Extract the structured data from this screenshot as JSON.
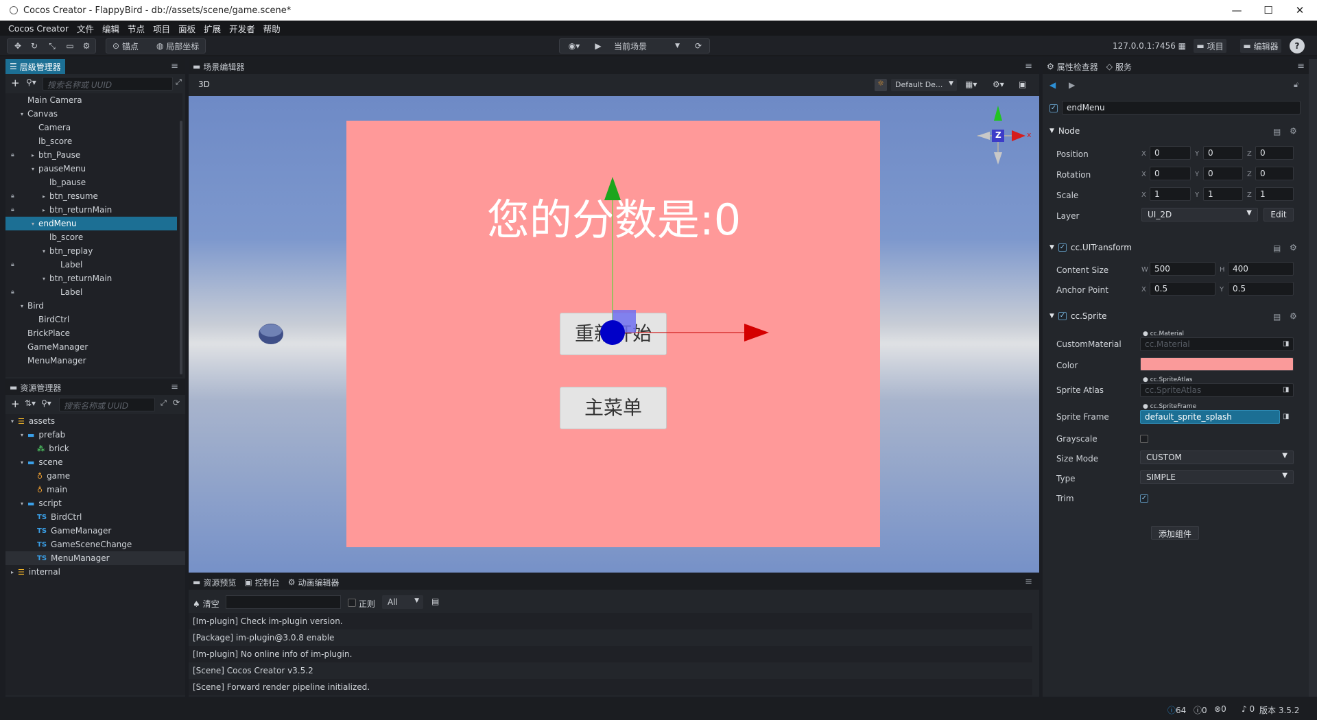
{
  "window": {
    "title": "Cocos Creator - FlappyBird - db://assets/scene/game.scene*",
    "controls": [
      "—",
      "☐",
      "✕"
    ]
  },
  "menubar": [
    "Cocos Creator",
    "文件",
    "编辑",
    "节点",
    "项目",
    "面板",
    "扩展",
    "开发者",
    "帮助"
  ],
  "toolbar": {
    "pivot": "锚点",
    "local": "局部坐标",
    "scene_select": "当前场景",
    "ip": "127.0.0.1:7456",
    "project_btn": "项目",
    "editor_btn": "编辑器"
  },
  "hierarchy": {
    "tab": "层级管理器",
    "search_placeholder": "搜索名称或 UUID",
    "items": [
      {
        "label": "Main Camera",
        "depth": 1,
        "arrow": "",
        "lock": false
      },
      {
        "label": "Canvas",
        "depth": 1,
        "arrow": "▾",
        "lock": false
      },
      {
        "label": "Camera",
        "depth": 2,
        "arrow": "",
        "lock": false
      },
      {
        "label": "lb_score",
        "depth": 2,
        "arrow": "",
        "lock": false
      },
      {
        "label": "btn_Pause",
        "depth": 2,
        "arrow": "▸",
        "lock": true
      },
      {
        "label": "pauseMenu",
        "depth": 2,
        "arrow": "▾",
        "lock": false
      },
      {
        "label": "lb_pause",
        "depth": 3,
        "arrow": "",
        "lock": false
      },
      {
        "label": "btn_resume",
        "depth": 3,
        "arrow": "▸",
        "lock": true
      },
      {
        "label": "btn_returnMain",
        "depth": 3,
        "arrow": "▸",
        "lock": true
      },
      {
        "label": "endMenu",
        "depth": 2,
        "arrow": "▾",
        "lock": false,
        "selected": true
      },
      {
        "label": "lb_score",
        "depth": 3,
        "arrow": "",
        "lock": false
      },
      {
        "label": "btn_replay",
        "depth": 3,
        "arrow": "▾",
        "lock": false
      },
      {
        "label": "Label",
        "depth": 4,
        "arrow": "",
        "lock": true
      },
      {
        "label": "btn_returnMain",
        "depth": 3,
        "arrow": "▾",
        "lock": false
      },
      {
        "label": "Label",
        "depth": 4,
        "arrow": "",
        "lock": true
      },
      {
        "label": "Bird",
        "depth": 1,
        "arrow": "▾",
        "lock": false
      },
      {
        "label": "BirdCtrl",
        "depth": 2,
        "arrow": "",
        "lock": false
      },
      {
        "label": "BrickPlace",
        "depth": 1,
        "arrow": "",
        "lock": false
      },
      {
        "label": "GameManager",
        "depth": 1,
        "arrow": "",
        "lock": false
      },
      {
        "label": "MenuManager",
        "depth": 1,
        "arrow": "",
        "lock": false
      }
    ]
  },
  "assets": {
    "tab": "资源管理器",
    "search_placeholder": "搜索名称或 UUID",
    "items": [
      {
        "label": "assets",
        "depth": 0,
        "arrow": "▾",
        "icon": "db"
      },
      {
        "label": "prefab",
        "depth": 1,
        "arrow": "▾",
        "icon": "folder"
      },
      {
        "label": "brick",
        "depth": 2,
        "arrow": "",
        "icon": "prefab"
      },
      {
        "label": "scene",
        "depth": 1,
        "arrow": "▾",
        "icon": "folder"
      },
      {
        "label": "game",
        "depth": 2,
        "arrow": "",
        "icon": "scene"
      },
      {
        "label": "main",
        "depth": 2,
        "arrow": "",
        "icon": "scene"
      },
      {
        "label": "script",
        "depth": 1,
        "arrow": "▾",
        "icon": "folder"
      },
      {
        "label": "BirdCtrl",
        "depth": 2,
        "arrow": "",
        "icon": "ts"
      },
      {
        "label": "GameManager",
        "depth": 2,
        "arrow": "",
        "icon": "ts"
      },
      {
        "label": "GameSceneChange",
        "depth": 2,
        "arrow": "",
        "icon": "ts"
      },
      {
        "label": "MenuManager",
        "depth": 2,
        "arrow": "",
        "icon": "ts",
        "hover": true
      },
      {
        "label": "internal",
        "depth": 0,
        "arrow": "▸",
        "icon": "db"
      }
    ],
    "ts_badge": "TS"
  },
  "scene_editor": {
    "tab": "场景编辑器",
    "mode": "3D",
    "camera_select": "Default De...",
    "canvas_text": "您的分数是:0",
    "btn_replay": "重新开始",
    "btn_main": "主菜单",
    "gizmo_z": "Z",
    "gizmo_x": "x",
    "canvas_color": "#ff9999"
  },
  "console": {
    "tabs": [
      "资源预览",
      "控制台",
      "动画编辑器"
    ],
    "clear": "清空",
    "regex": "正则",
    "filter": "All",
    "lines": [
      "[Im-plugin] Check im-plugin version.",
      "[Package] im-plugin@3.0.8 enable",
      "[Im-plugin] No online info of im-plugin.",
      "[Scene] Cocos Creator v3.5.2",
      "[Scene] Forward render pipeline initialized."
    ]
  },
  "inspector": {
    "tabs": [
      "属性检查器",
      "服务"
    ],
    "node_name": "endMenu",
    "node_section": "Node",
    "position": {
      "label": "Position",
      "x": "0",
      "y": "0",
      "z": "0"
    },
    "rotation": {
      "label": "Rotation",
      "x": "0",
      "y": "0",
      "z": "0"
    },
    "scale": {
      "label": "Scale",
      "x": "1",
      "y": "1",
      "z": "1"
    },
    "layer": {
      "label": "Layer",
      "value": "UI_2D",
      "edit": "Edit"
    },
    "uitransform": {
      "title": "cc.UITransform",
      "content_size": "Content Size",
      "w": "500",
      "h": "400",
      "anchor": "Anchor Point",
      "ax": "0.5",
      "ay": "0.5"
    },
    "sprite": {
      "title": "cc.Sprite",
      "custom_material": "CustomMaterial",
      "material_tag": "cc.Material",
      "material_value": "cc.Material",
      "color": "Color",
      "color_value": "#fa9a9a",
      "sprite_atlas": "Sprite Atlas",
      "atlas_tag": "cc.SpriteAtlas",
      "atlas_value": "cc.SpriteAtlas",
      "sprite_frame": "Sprite Frame",
      "frame_tag": "cc.SpriteFrame",
      "frame_value": "default_sprite_splash",
      "grayscale": "Grayscale",
      "size_mode": "Size Mode",
      "size_mode_value": "CUSTOM",
      "type": "Type",
      "type_value": "SIMPLE",
      "trim": "Trim"
    },
    "add_component": "添加组件",
    "axis": {
      "x": "X",
      "y": "Y",
      "z": "Z",
      "w": "W",
      "h": "H"
    }
  },
  "statusbar": {
    "info": "64",
    "warn": "0",
    "err": "0",
    "notice": "0",
    "version": "版本 3.5.2"
  }
}
